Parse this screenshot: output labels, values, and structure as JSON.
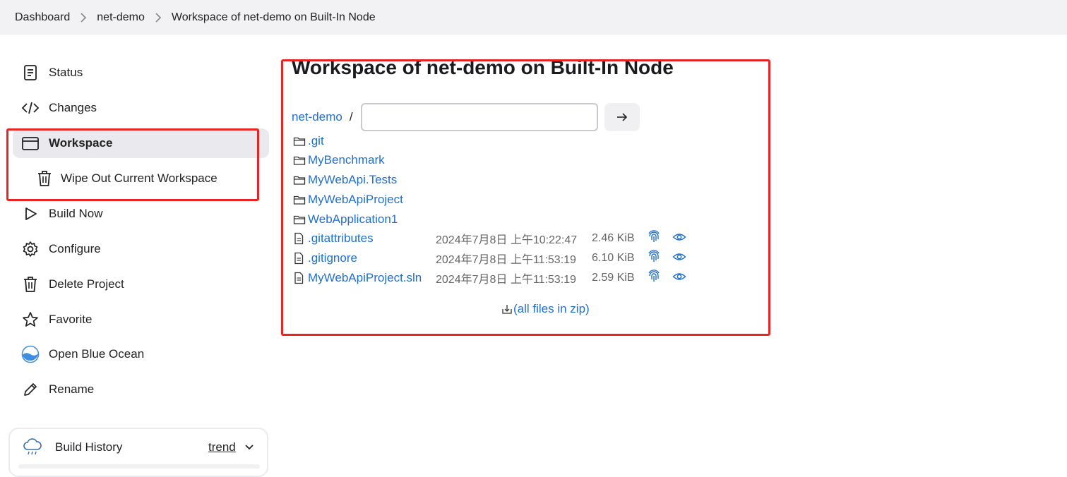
{
  "breadcrumb": {
    "items": [
      "Dashboard",
      "net-demo",
      "Workspace of net-demo on Built-In Node"
    ]
  },
  "sidebar": {
    "items": [
      {
        "label": "Status",
        "icon": "status-icon"
      },
      {
        "label": "Changes",
        "icon": "code-icon"
      },
      {
        "label": "Workspace",
        "icon": "folder-icon",
        "active": true
      },
      {
        "label": "Wipe Out Current Workspace",
        "icon": "trash-icon"
      },
      {
        "label": "Build Now",
        "icon": "play-icon"
      },
      {
        "label": "Configure",
        "icon": "gear-icon"
      },
      {
        "label": "Delete Project",
        "icon": "trash-icon"
      },
      {
        "label": "Favorite",
        "icon": "star-icon"
      },
      {
        "label": "Open Blue Ocean",
        "icon": "blue-ocean-icon"
      },
      {
        "label": "Rename",
        "icon": "pencil-icon"
      }
    ],
    "build_history": {
      "label": "Build History",
      "trend": "trend",
      "icon": "cloud-rain-icon"
    }
  },
  "main": {
    "title": "Workspace of net-demo on Built-In Node",
    "path_root": "net-demo",
    "path_sep": "/",
    "path_input_value": "",
    "folders": [
      ".git",
      "MyBenchmark",
      "MyWebApi.Tests",
      "MyWebApiProject",
      "WebApplication1"
    ],
    "files": [
      {
        "name": ".gitattributes",
        "date": "2024年7月8日 上午10:22:47",
        "size": "2.46 KiB"
      },
      {
        "name": ".gitignore",
        "date": "2024年7月8日 上午11:53:19",
        "size": "6.10 KiB"
      },
      {
        "name": "MyWebApiProject.sln",
        "date": "2024年7月8日 上午11:53:19",
        "size": "2.59 KiB"
      }
    ],
    "zip_label": "(all files in zip)"
  },
  "colors": {
    "link": "#1f6fd1",
    "highlight": "#e82525",
    "breadcrumb_bg": "#f2f2f4"
  }
}
